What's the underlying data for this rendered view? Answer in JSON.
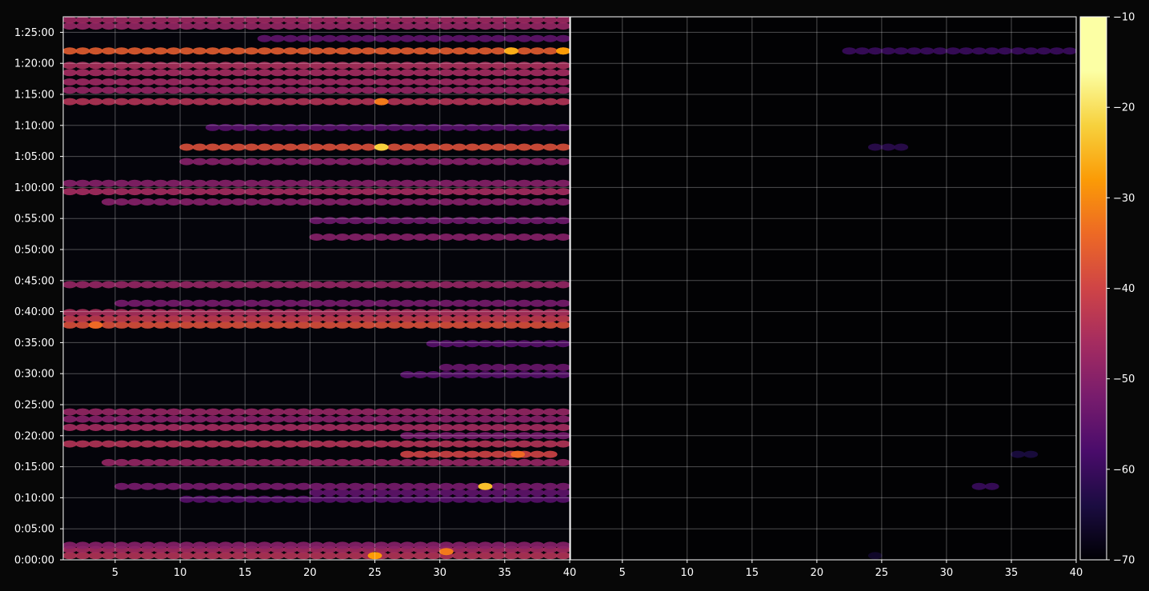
{
  "chart_data": {
    "type": "heatmap",
    "title": "",
    "xlabel": "",
    "ylabel": "",
    "grid": true,
    "background": "#000000",
    "colormap": "inferno",
    "panels": [
      {
        "name": "",
        "xlim": [
          1,
          40
        ],
        "ylim_seconds": [
          0,
          5250
        ],
        "xticks": [
          5,
          10,
          15,
          20,
          25,
          30,
          35,
          40
        ],
        "xtick_labels": [
          "5",
          "10",
          "15",
          "20",
          "25",
          "30",
          "35",
          "40"
        ],
        "bands": [
          {
            "t": "0:00:40",
            "x": [
              1,
              39
            ],
            "db": -44
          },
          {
            "t": "0:01:40",
            "x": [
              1,
              39
            ],
            "db": -46
          },
          {
            "t": "0:02:20",
            "x": [
              1,
              39
            ],
            "db": -50
          },
          {
            "t": "0:09:45",
            "x": [
              10,
              39
            ],
            "db": -56
          },
          {
            "t": "0:10:50",
            "x": [
              20,
              39
            ],
            "db": -55
          },
          {
            "t": "0:11:50",
            "x": [
              5,
              39
            ],
            "db": -52
          },
          {
            "t": "0:15:40",
            "x": [
              4,
              39
            ],
            "db": -48
          },
          {
            "t": "0:17:00",
            "x": [
              27,
              38
            ],
            "db": -40
          },
          {
            "t": "0:18:40",
            "x": [
              1,
              39
            ],
            "db": -44
          },
          {
            "t": "0:20:00",
            "x": [
              27,
              39
            ],
            "db": -52
          },
          {
            "t": "0:21:20",
            "x": [
              1,
              39
            ],
            "db": -46
          },
          {
            "t": "0:22:40",
            "x": [
              1,
              39
            ],
            "db": -50
          },
          {
            "t": "0:23:50",
            "x": [
              1,
              39
            ],
            "db": -48
          },
          {
            "t": "0:29:50",
            "x": [
              27,
              39
            ],
            "db": -56
          },
          {
            "t": "0:31:00",
            "x": [
              30,
              39
            ],
            "db": -54
          },
          {
            "t": "0:34:50",
            "x": [
              29,
              39
            ],
            "db": -56
          },
          {
            "t": "0:37:50",
            "x": [
              1,
              39
            ],
            "db": -38
          },
          {
            "t": "0:38:50",
            "x": [
              1,
              39
            ],
            "db": -42
          },
          {
            "t": "0:39:50",
            "x": [
              1,
              39
            ],
            "db": -45
          },
          {
            "t": "0:41:20",
            "x": [
              5,
              39
            ],
            "db": -52
          },
          {
            "t": "0:44:20",
            "x": [
              1,
              39
            ],
            "db": -48
          },
          {
            "t": "0:52:00",
            "x": [
              20,
              39
            ],
            "db": -50
          },
          {
            "t": "0:54:40",
            "x": [
              20,
              39
            ],
            "db": -53
          },
          {
            "t": "0:57:40",
            "x": [
              4,
              39
            ],
            "db": -50
          },
          {
            "t": "0:59:20",
            "x": [
              1,
              39
            ],
            "db": -46
          },
          {
            "t": "1:00:40",
            "x": [
              1,
              39
            ],
            "db": -50
          },
          {
            "t": "1:04:10",
            "x": [
              10,
              39
            ],
            "db": -50
          },
          {
            "t": "1:06:30",
            "x": [
              10,
              39
            ],
            "db": -38
          },
          {
            "t": "1:09:40",
            "x": [
              12,
              39
            ],
            "db": -56
          },
          {
            "t": "1:13:50",
            "x": [
              1,
              39
            ],
            "db": -44
          },
          {
            "t": "1:15:40",
            "x": [
              1,
              39
            ],
            "db": -48
          },
          {
            "t": "1:17:00",
            "x": [
              1,
              39
            ],
            "db": -47
          },
          {
            "t": "1:18:30",
            "x": [
              1,
              39
            ],
            "db": -46
          },
          {
            "t": "1:19:40",
            "x": [
              1,
              39
            ],
            "db": -45
          },
          {
            "t": "1:22:00",
            "x": [
              1,
              39
            ],
            "db": -36
          },
          {
            "t": "1:24:00",
            "x": [
              16,
              39
            ],
            "db": -55
          },
          {
            "t": "1:26:00",
            "x": [
              1,
              39
            ],
            "db": -48
          },
          {
            "t": "1:27:00",
            "x": [
              1,
              39
            ],
            "db": -47
          },
          {
            "t": "1:28:00",
            "x": [
              1,
              39
            ],
            "db": -48
          }
        ],
        "hotspots": [
          {
            "t": "0:00:40",
            "x": 24.5,
            "db": -28
          },
          {
            "t": "0:01:20",
            "x": 30,
            "db": -32
          },
          {
            "t": "0:11:50",
            "x": 33,
            "db": -24
          },
          {
            "t": "0:17:00",
            "x": 35.5,
            "db": -34
          },
          {
            "t": "0:37:50",
            "x": 3,
            "db": -34
          },
          {
            "t": "1:06:30",
            "x": 25,
            "db": -22
          },
          {
            "t": "1:13:50",
            "x": 25,
            "db": -32
          },
          {
            "t": "1:22:00",
            "x": 35,
            "db": -26
          },
          {
            "t": "1:22:00",
            "x": 39,
            "db": -28
          }
        ]
      },
      {
        "name": "",
        "xlim": [
          1,
          40
        ],
        "ylim_seconds": [
          0,
          5250
        ],
        "xticks": [
          5,
          10,
          15,
          20,
          25,
          30,
          35,
          40
        ],
        "xtick_labels": [
          "5",
          "10",
          "15",
          "20",
          "25",
          "30",
          "35",
          "40"
        ],
        "bands": [
          {
            "t": "1:22:00",
            "x": [
              22,
              39
            ],
            "db": -60
          },
          {
            "t": "1:06:30",
            "x": [
              24,
              26
            ],
            "db": -62
          },
          {
            "t": "0:11:50",
            "x": [
              32,
              33
            ],
            "db": -60
          },
          {
            "t": "0:17:00",
            "x": [
              35,
              36
            ],
            "db": -64
          },
          {
            "t": "0:00:40",
            "x": [
              24,
              24
            ],
            "db": -66
          }
        ],
        "hotspots": []
      }
    ],
    "yticks_seconds": [
      0,
      300,
      600,
      900,
      1200,
      1500,
      1800,
      2100,
      2400,
      2700,
      3000,
      3300,
      3600,
      3900,
      4200,
      4500,
      4800,
      5100
    ],
    "ytick_labels": [
      "0:00:00",
      "0:05:00",
      "0:10:00",
      "0:15:00",
      "0:20:00",
      "0:25:00",
      "0:30:00",
      "0:35:00",
      "0:40:00",
      "0:45:00",
      "0:50:00",
      "0:55:00",
      "1:00:00",
      "1:05:00",
      "1:10:00",
      "1:15:00",
      "1:20:00",
      "1:25:00"
    ],
    "colorbar": {
      "min": -70,
      "max": -10,
      "ticks": [
        -70,
        -60,
        -50,
        -40,
        -30,
        -20,
        -10
      ],
      "tick_labels": [
        "−70",
        "−60",
        "−50",
        "−40",
        "−30",
        "−20",
        "−10"
      ]
    }
  }
}
